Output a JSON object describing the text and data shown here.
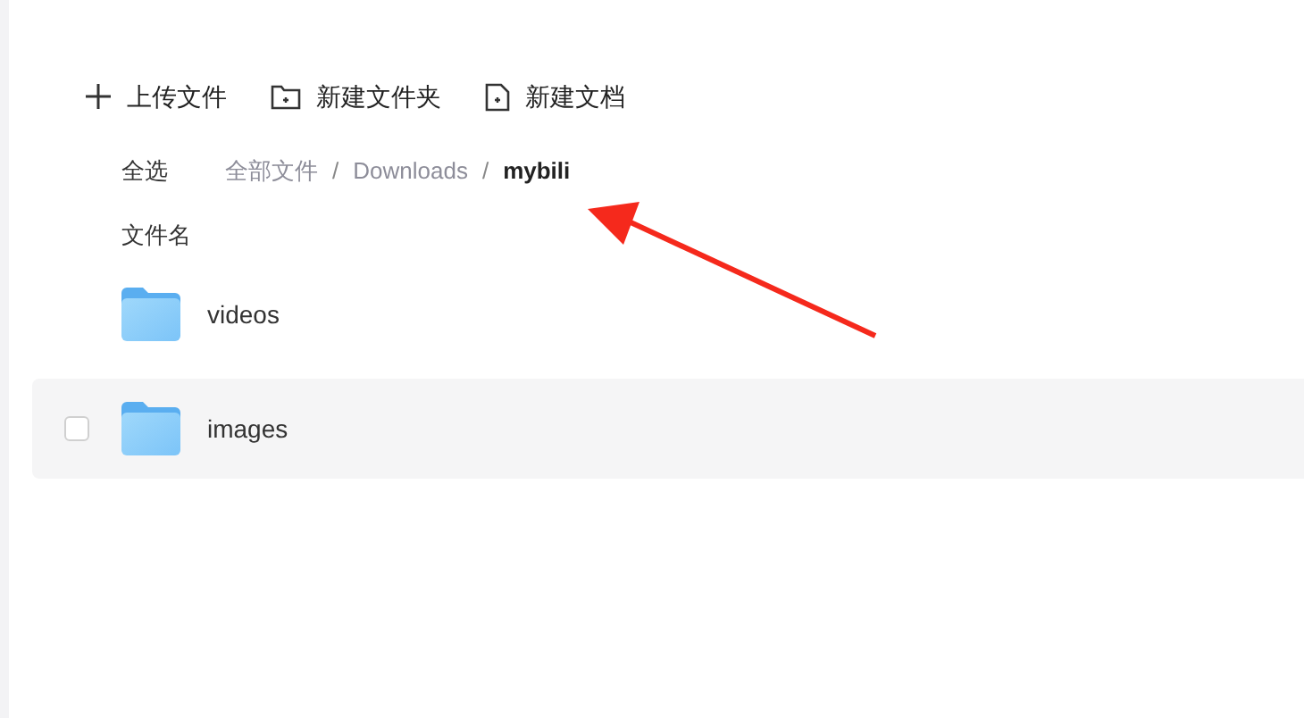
{
  "toolbar": [
    {
      "kind": "upload",
      "label": "上传文件"
    },
    {
      "kind": "new-folder",
      "label": "新建文件夹"
    },
    {
      "kind": "new-doc",
      "label": "新建文档"
    }
  ],
  "select_all": "全选",
  "breadcrumb": [
    {
      "label": "全部文件",
      "selected": false
    },
    {
      "label": "Downloads",
      "selected": false
    },
    {
      "label": "mybili",
      "selected": true
    }
  ],
  "breadcrumb_separator": "/",
  "column_header": "文件名",
  "rows": [
    {
      "name": "videos",
      "hovered": false
    },
    {
      "name": "images",
      "hovered": true,
      "checked": false
    }
  ],
  "annotations": [
    {
      "kind": "arrow"
    }
  ]
}
